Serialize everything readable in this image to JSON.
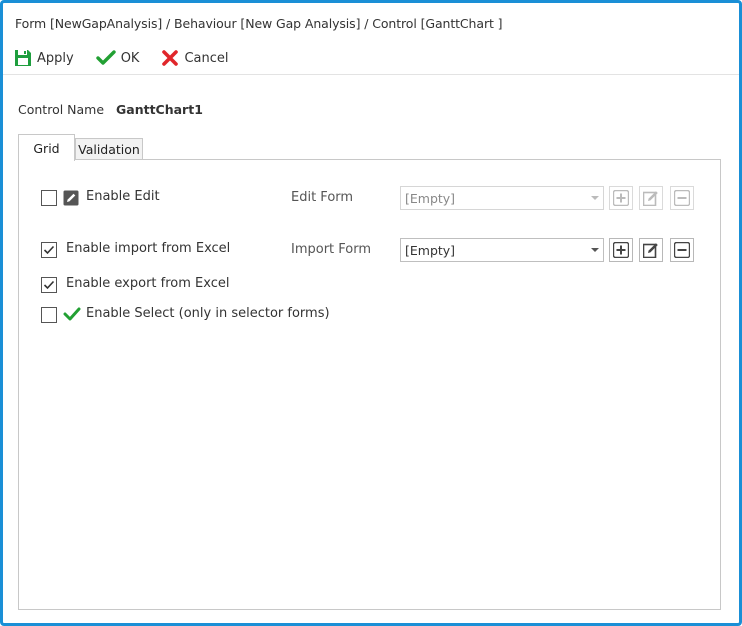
{
  "window": {
    "title": "Form [NewGapAnalysis] / Behaviour [New Gap Analysis] / Control [GanttChart ]"
  },
  "toolbar": {
    "apply_label": "Apply",
    "ok_label": "OK",
    "cancel_label": "Cancel"
  },
  "control": {
    "name_label": "Control Name",
    "name_value": "GanttChart1"
  },
  "tabs": [
    {
      "label": "Grid",
      "active": true
    },
    {
      "label": "Validation",
      "active": false
    }
  ],
  "options": {
    "enable_edit": {
      "label": "Enable Edit",
      "checked": false
    },
    "enable_import": {
      "label": "Enable import from Excel",
      "checked": true
    },
    "enable_export": {
      "label": "Enable export from Excel",
      "checked": true
    },
    "enable_select": {
      "label": "Enable Select (only in selector forms)",
      "checked": false
    }
  },
  "edit_form": {
    "label": "Edit Form",
    "value": "[Empty]",
    "enabled": false
  },
  "import_form": {
    "label": "Import Form",
    "value": "[Empty]",
    "enabled": true
  },
  "colors": {
    "border_accent": "#1a8fd6",
    "apply_green": "#1e9e3e",
    "ok_green": "#22a033",
    "cancel_red": "#e0262b"
  },
  "icons": {
    "apply": "save-icon",
    "ok": "checkmark-icon",
    "cancel": "x-icon",
    "edit": "pencil-icon",
    "select": "checkmark-icon",
    "add": "plus-icon",
    "edit_btn": "edit-icon",
    "remove": "minus-icon"
  }
}
